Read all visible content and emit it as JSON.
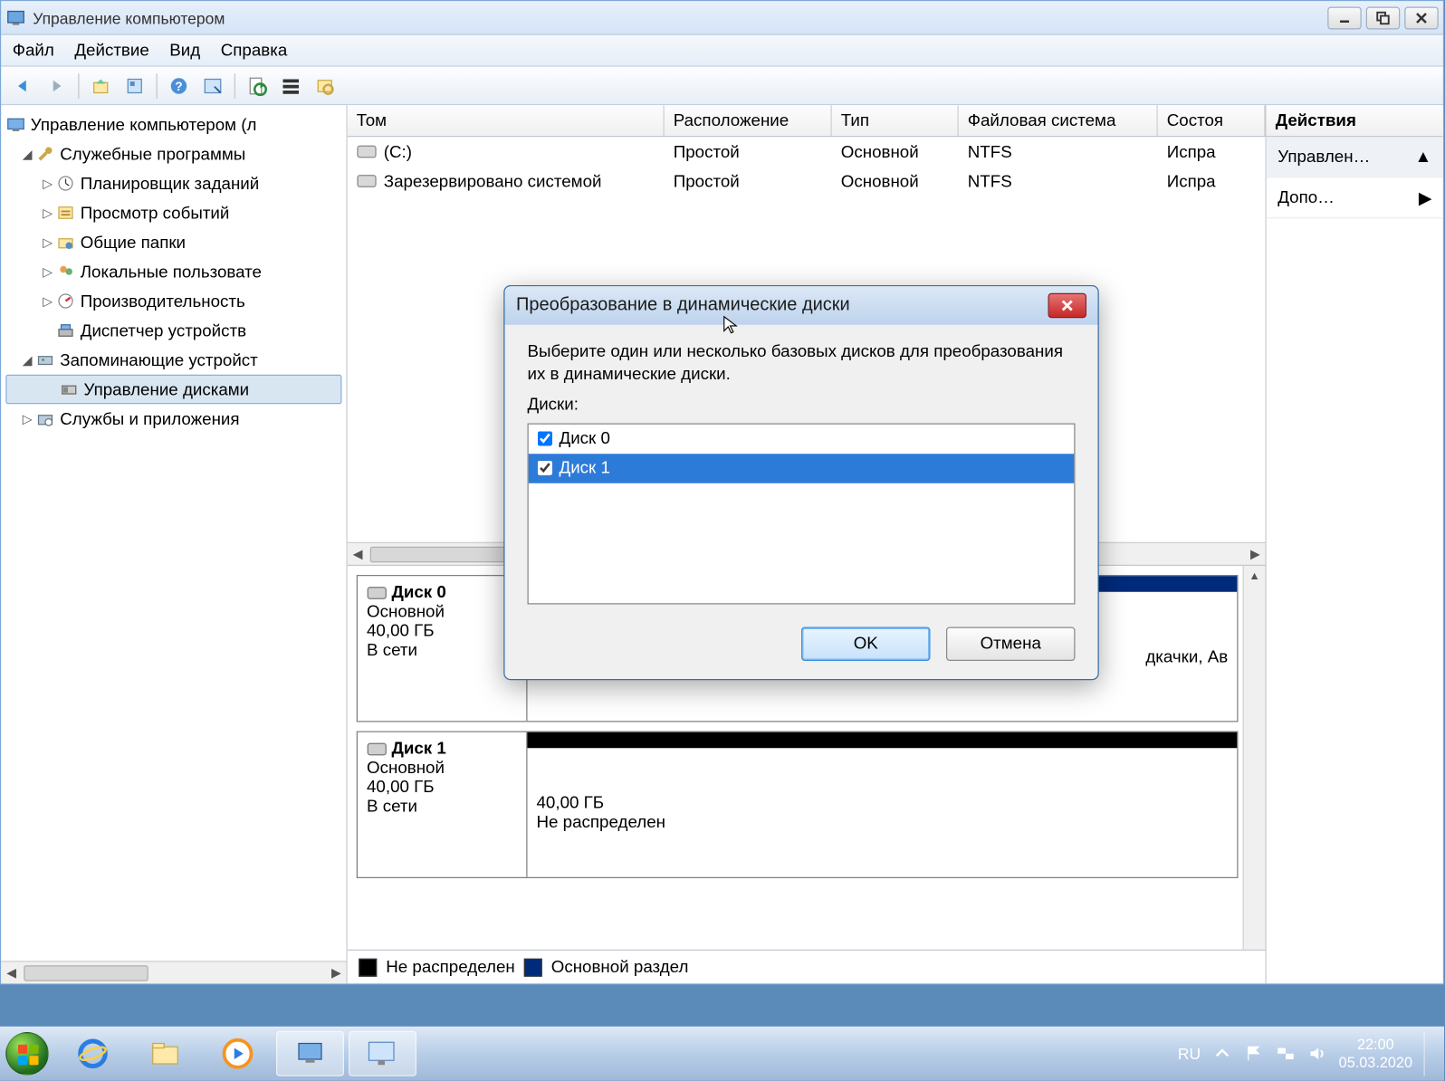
{
  "window": {
    "title": "Управление компьютером",
    "menu": [
      "Файл",
      "Действие",
      "Вид",
      "Справка"
    ]
  },
  "tree": {
    "root": "Управление компьютером (л",
    "group1": "Служебные программы",
    "group1_items": [
      "Планировщик заданий",
      "Просмотр событий",
      "Общие папки",
      "Локальные пользовате",
      "Производительность",
      "Диспетчер устройств"
    ],
    "group2": "Запоминающие устройст",
    "group2_item": "Управление дисками",
    "group3": "Службы и приложения"
  },
  "volumes": {
    "headers": [
      "Том",
      "Расположение",
      "Тип",
      "Файловая система",
      "Состоя"
    ],
    "rows": [
      {
        "name": "(C:)",
        "layout": "Простой",
        "type": "Основной",
        "fs": "NTFS",
        "status": "Испра"
      },
      {
        "name": "Зарезервировано системой",
        "layout": "Простой",
        "type": "Основной",
        "fs": "NTFS",
        "status": "Испра"
      }
    ]
  },
  "disks": [
    {
      "title": "Диск 0",
      "type": "Основной",
      "size": "40,00 ГБ",
      "status": "В сети",
      "partition": {
        "suffix": "дкачки, Ав",
        "style": "primary"
      }
    },
    {
      "title": "Диск 1",
      "type": "Основной",
      "size": "40,00 ГБ",
      "status": "В сети",
      "partition": {
        "size": "40,00 ГБ",
        "status": "Не распределен",
        "style": "unalloc"
      }
    }
  ],
  "legend": {
    "unalloc": "Не распределен",
    "primary": "Основной раздел"
  },
  "actions": {
    "header": "Действия",
    "row1": "Управлен…",
    "row2": "Допо…"
  },
  "dialog": {
    "title": "Преобразование в динамические диски",
    "instruction": "Выберите один или несколько базовых дисков для преобразования их в динамические диски.",
    "list_label": "Диски:",
    "items": [
      {
        "label": "Диск 0",
        "checked": true,
        "selected": false
      },
      {
        "label": "Диск 1",
        "checked": true,
        "selected": true
      }
    ],
    "ok": "OK",
    "cancel": "Отмена"
  },
  "taskbar": {
    "lang": "RU",
    "time": "22:00",
    "date": "05.03.2020"
  }
}
